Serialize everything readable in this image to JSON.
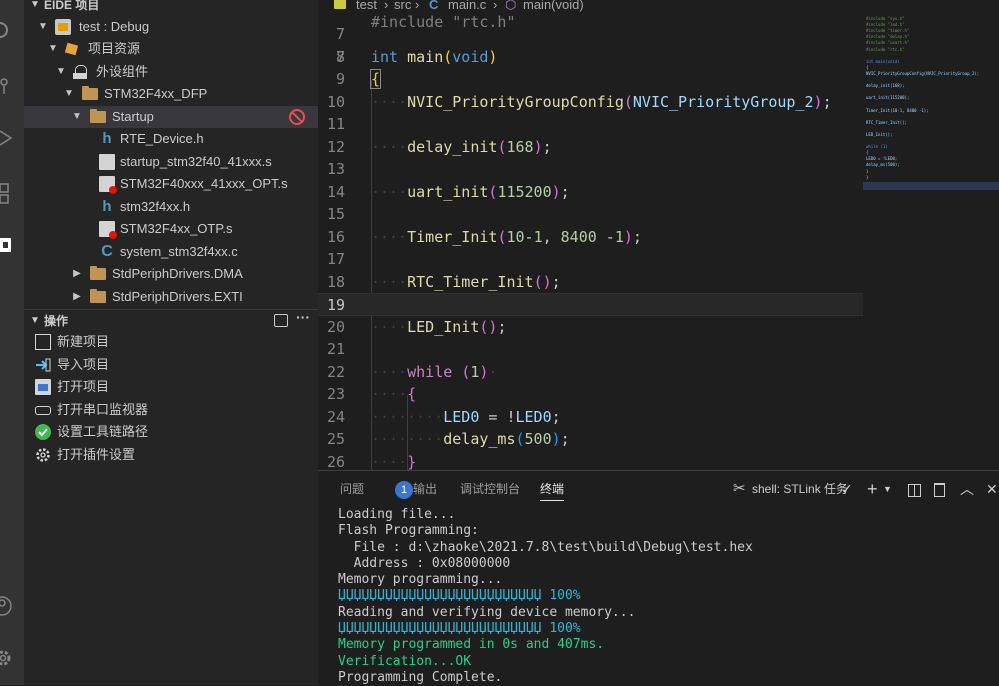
{
  "colors": {
    "accent": "#3a76d0",
    "error": "#f14c4c",
    "progress": "#29b8db",
    "success": "#23d18b"
  },
  "activity_bar": {
    "icons": [
      "files-icon",
      "search-icon",
      "run-debug-icon",
      "extensions-icon",
      "eide-icon",
      "account-icon",
      "settings-gear-icon"
    ]
  },
  "sidebar": {
    "project_section_title": "EIDE 项目",
    "tree": [
      {
        "label": "test : Debug"
      },
      {
        "label": "项目资源"
      },
      {
        "label": "外设组件"
      },
      {
        "label": "STM32F4xx_DFP"
      },
      {
        "label": "Startup"
      },
      {
        "label": "RTE_Device.h"
      },
      {
        "label": "startup_stm32f40_41xxx.s"
      },
      {
        "label": "STM32F40xxx_41xxx_OPT.s"
      },
      {
        "label": "stm32f4xx.h"
      },
      {
        "label": "STM32F4xx_OTP.s"
      },
      {
        "label": "system_stm32f4xx.c"
      },
      {
        "label": "StdPeriphDrivers.DMA"
      },
      {
        "label": "StdPeriphDrivers.EXTI"
      }
    ],
    "ops_section_title": "操作",
    "ops": [
      {
        "label": "新建项目"
      },
      {
        "label": "导入项目"
      },
      {
        "label": "打开项目"
      },
      {
        "label": "打开串口监视器"
      },
      {
        "label": "设置工具链路径"
      },
      {
        "label": "打开插件设置"
      }
    ]
  },
  "editor": {
    "breadcrumb": [
      "test",
      "src",
      "main.c",
      "main(void)"
    ],
    "top_partial_line": "#include \"rtc.h\"",
    "line_numbers": [
      "7",
      "8",
      "9",
      "10",
      "11",
      "12",
      "13",
      "14",
      "15",
      "16",
      "17",
      "18",
      "19",
      "20",
      "21",
      "22",
      "23",
      "24",
      "25",
      "26"
    ],
    "current_line": "19"
  },
  "minimap": {
    "lines": [
      "#include \"sys.h\"",
      "#include \"led.h\"",
      "#include \"timer.h\"",
      "#include \"delay.h\"",
      "#include \"usart.h\"",
      "#include \"rtc.h\"",
      "",
      "int main(void)",
      "{",
      "  NVIC_PriorityGroupConfig(NVIC_PriorityGroup_2);",
      "",
      "  delay_init(168);",
      "",
      "  uart_init(115200);",
      "",
      "  Timer_Init(10-1, 8400 -1);",
      "",
      "  RTC_Timer_Init();",
      "",
      "  LED_Init();",
      "",
      "  while (1)",
      "  {",
      "    LED0 = !LED0;",
      "    delay_ms(500);",
      "  }",
      "}"
    ]
  },
  "panel": {
    "tabs": [
      {
        "label": "问题",
        "badge": "1"
      },
      {
        "label": "输出"
      },
      {
        "label": "调试控制台"
      },
      {
        "label": "终端"
      }
    ],
    "terminal_name": "shell: STLink 任务",
    "terminal_lines": [
      "Loading file...",
      "Flash Programming:",
      "  File : d:\\zhaoke\\2021.7.8\\test\\build\\Debug\\test.hex",
      "  Address : 0x08000000",
      "Memory programming...",
      "ЏЏЏЏЏЏЏЏЏЏЏЏЏЏЏЏЏЏЏЏЏЏЏЏЏЏ 100%",
      "Reading and verifying device memory...",
      "ЏЏЏЏЏЏЏЏЏЏЏЏЏЏЏЏЏЏЏЏЏЏЏЏЏЏ 100%",
      "Memory programmed in 0s and 407ms.",
      "Verification...OK",
      "Programming Complete."
    ]
  }
}
